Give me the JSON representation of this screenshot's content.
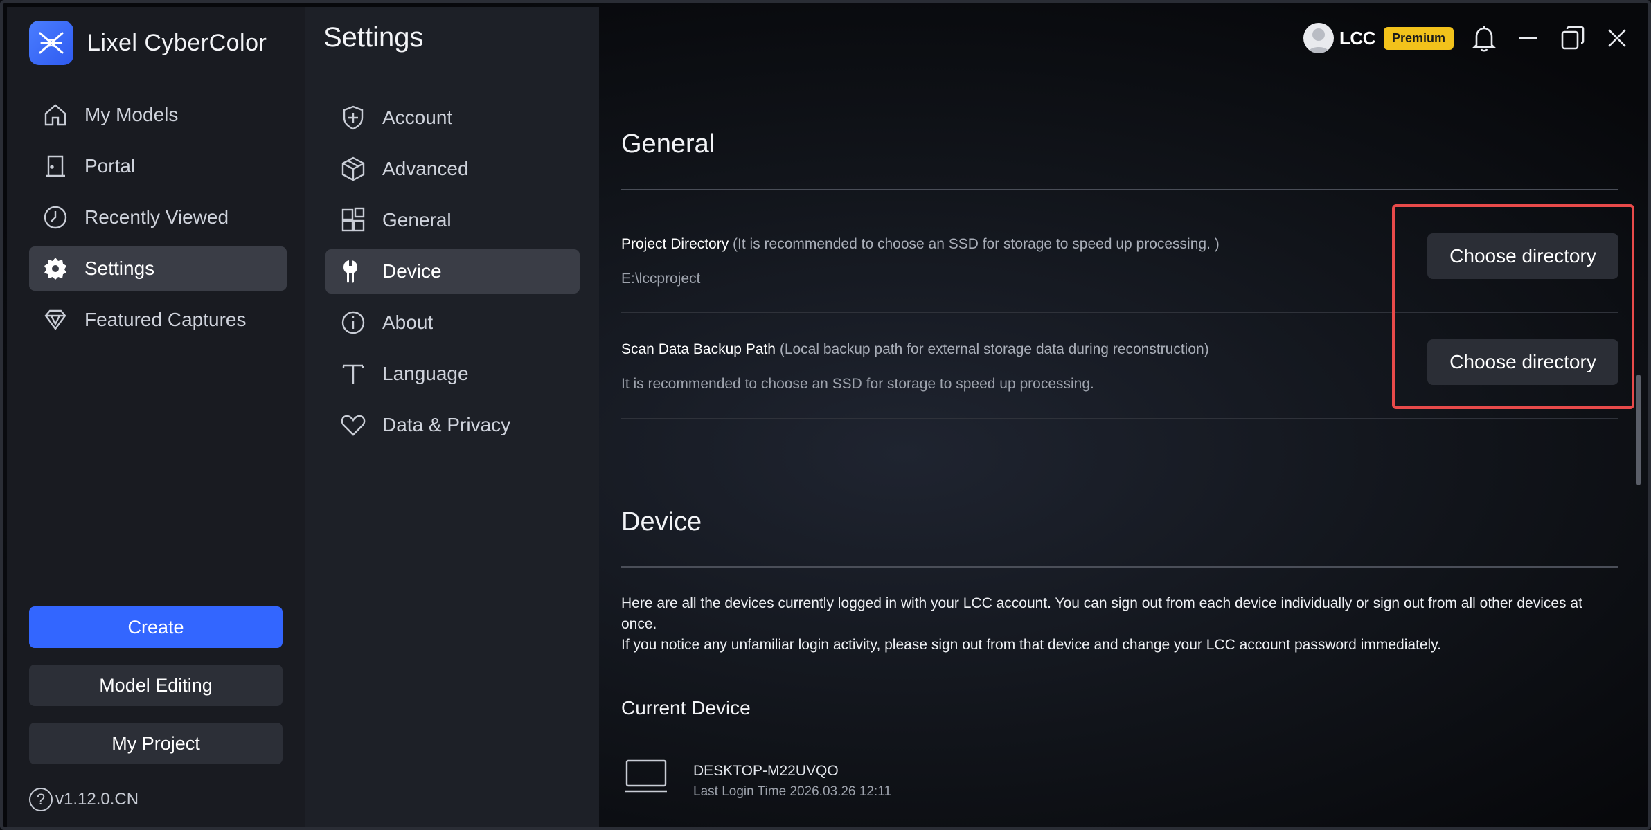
{
  "app": {
    "name": "Lixel CyberColor",
    "version": "v1.12.0.CN"
  },
  "sidebar": {
    "items": [
      {
        "label": "My Models",
        "icon": "home-icon"
      },
      {
        "label": "Portal",
        "icon": "door-icon"
      },
      {
        "label": "Recently Viewed",
        "icon": "clock-icon"
      },
      {
        "label": "Settings",
        "icon": "gear-icon",
        "active": true
      },
      {
        "label": "Featured Captures",
        "icon": "diamond-icon"
      }
    ],
    "create_label": "Create",
    "model_editing_label": "Model Editing",
    "my_project_label": "My Project"
  },
  "settings_menu": {
    "title": "Settings",
    "items": [
      {
        "label": "Account",
        "icon": "shield-icon"
      },
      {
        "label": "Advanced",
        "icon": "cube-icon"
      },
      {
        "label": "General",
        "icon": "grid-icon"
      },
      {
        "label": "Device",
        "icon": "wrench-icon",
        "active": true
      },
      {
        "label": "About",
        "icon": "info-icon"
      },
      {
        "label": "Language",
        "icon": "text-icon"
      },
      {
        "label": "Data & Privacy",
        "icon": "heart-icon"
      }
    ]
  },
  "titlebar": {
    "user": "LCC",
    "badge": "Premium"
  },
  "general": {
    "title": "General",
    "project_directory": {
      "label": "Project Directory",
      "hint": "(It is recommended to choose an SSD for storage to speed up processing. )",
      "value": "E:\\lccproject",
      "button": "Choose directory"
    },
    "scan_backup": {
      "label": "Scan Data Backup Path",
      "hint": "(Local backup path for external storage data during reconstruction)",
      "value": "It is recommended to choose an SSD for storage to speed up processing.",
      "button": "Choose directory"
    }
  },
  "device": {
    "title": "Device",
    "description_1": "Here are all the devices currently logged in with your LCC account. You can sign out from each device individually or sign out from all other devices at once.",
    "description_2": "If you notice any unfamiliar login activity, please sign out from that device and change your LCC account password immediately.",
    "current_device_title": "Current Device",
    "current_device_name": "DESKTOP-M22UVQO",
    "current_device_time": "Last Login Time 2026.03.26 12:11"
  },
  "colors": {
    "accent": "#3366ff",
    "premium": "#f2c21b",
    "highlight": "#e84a4a",
    "active_bg": "#3a3d46"
  }
}
